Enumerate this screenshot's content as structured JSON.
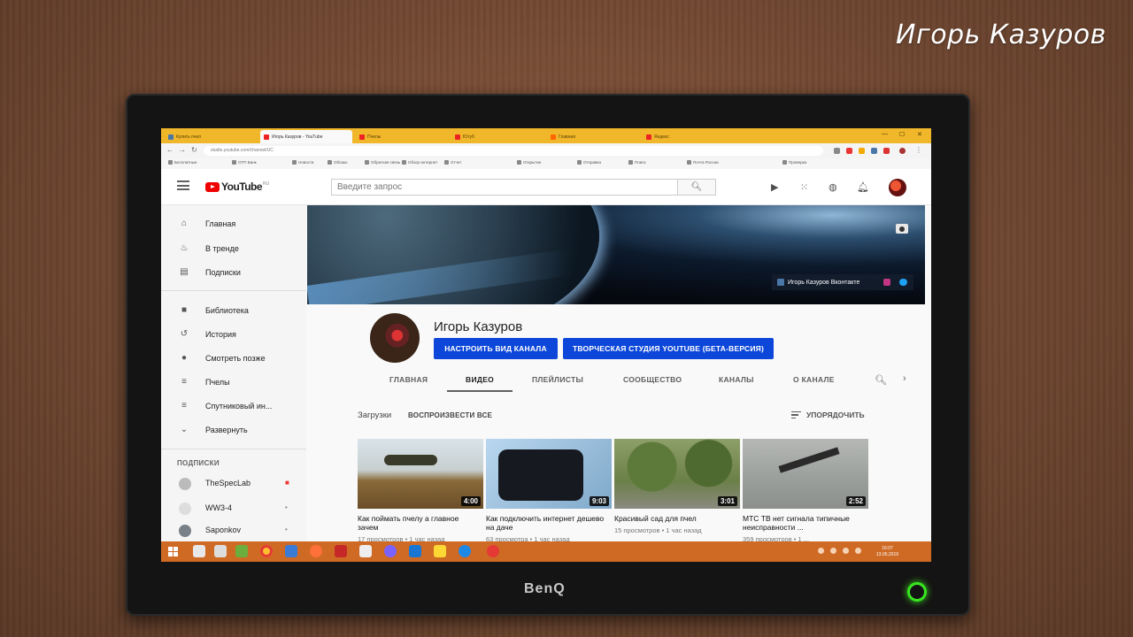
{
  "watermark": "Игорь Казуров",
  "monitor_brand": "BenQ",
  "browser": {
    "tabs": [
      {
        "label": "Купить пчел"
      },
      {
        "label": "Игорь Казуров - YouTube"
      },
      {
        "label": "Пчелы"
      },
      {
        "label": "Ютуб"
      },
      {
        "label": "Главная"
      },
      {
        "label": "Яндекс"
      }
    ],
    "url": "studio.youtube.com/channel/UC",
    "bookmarks": [
      "Бесплатные",
      "ОТП Банк",
      "Новости",
      "Облако",
      "Обратная связь",
      "Обзор интернет",
      "Отчет",
      "Открытие",
      "Отправка",
      "Поиск",
      "Почта России",
      "Проверка"
    ]
  },
  "header": {
    "logo": "YouTube",
    "logo_region": "RU",
    "search_placeholder": "Введите запрос",
    "icons": [
      "video-camera-icon",
      "apps-grid-icon",
      "messages-icon",
      "bell-icon",
      "avatar"
    ]
  },
  "sidebar": {
    "main": [
      {
        "label": "Главная",
        "icon": "home-icon"
      },
      {
        "label": "В тренде",
        "icon": "fire-icon"
      },
      {
        "label": "Подписки",
        "icon": "subscriptions-icon"
      }
    ],
    "library": [
      {
        "label": "Библиотека",
        "icon": "folder-icon"
      },
      {
        "label": "История",
        "icon": "history-icon"
      },
      {
        "label": "Смотреть позже",
        "icon": "clock-icon"
      },
      {
        "label": "Пчелы",
        "icon": "playlist-icon"
      },
      {
        "label": "Спутниковый ин...",
        "icon": "playlist-icon"
      },
      {
        "label": "Развернуть",
        "icon": "chevron-down-icon"
      }
    ],
    "subscriptions_heading": "ПОДПИСКИ",
    "subscriptions": [
      {
        "label": "TheSpecLab"
      },
      {
        "label": "WW3-4"
      },
      {
        "label": "Saponkov"
      }
    ]
  },
  "banner": {
    "link_label": "Игорь Казуров Вконтакте"
  },
  "channel": {
    "name": "Игорь Казуров",
    "btn_customize": "НАСТРОИТЬ ВИД КАНАЛА",
    "btn_studio": "ТВОРЧЕСКАЯ СТУДИЯ YOUTUBE (БЕТА-ВЕРСИЯ)",
    "tabs": [
      "ГЛАВНАЯ",
      "ВИДЕО",
      "ПЛЕЙЛИСТЫ",
      "СООБЩЕСТВО",
      "КАНАЛЫ",
      "О КАНАЛЕ"
    ],
    "active_tab": "ВИДЕО"
  },
  "uploads": {
    "label": "Загрузки",
    "play_all": "ВОСПРОИЗВЕСТИ ВСЕ",
    "sort_label": "УПОРЯДОЧИТЬ"
  },
  "videos": [
    {
      "title": "Как поймать пчелу а главное зачем",
      "duration": "4:00",
      "meta": "17 просмотров • 1 час назад"
    },
    {
      "title": "Как подключить интернет дешево на даче",
      "duration": "9:03",
      "meta": "63 просмотра • 1 час назад"
    },
    {
      "title": "Красивый сад для пчел",
      "duration": "3:01",
      "meta": "15 просмотров • 1 час назад"
    },
    {
      "title": "МТС ТВ нет сигнала типичные неисправности ...",
      "duration": "2:52",
      "meta": "359 просмотров • 1 ..."
    }
  ],
  "taskbar": {
    "clock_time": "16:07",
    "clock_date": "13.05.2019"
  }
}
